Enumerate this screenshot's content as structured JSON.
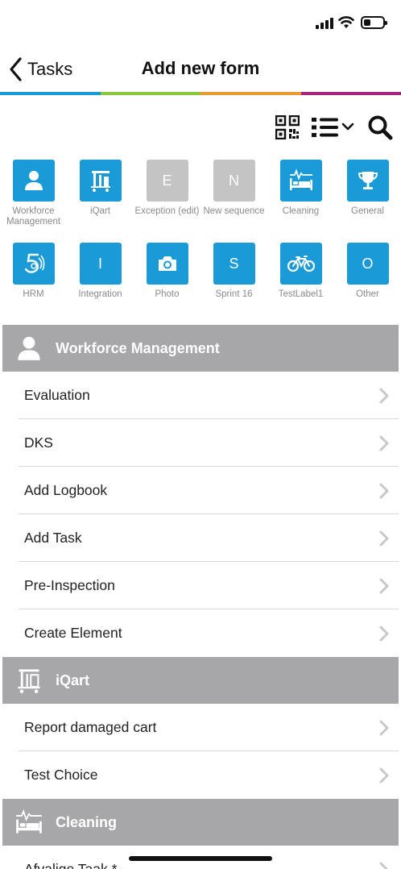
{
  "nav": {
    "back_label": "Tasks",
    "title": "Add new form"
  },
  "colors": {
    "accent": "#1a9bd7",
    "tile_disabled": "#c4c4c4",
    "section_header": "#a7a6a8",
    "rainbow": [
      "#1a9bd7",
      "#8cc63f",
      "#e89b2f",
      "#a8267b"
    ]
  },
  "toolbar": {
    "icons": [
      "qr-code-icon",
      "list-view-icon",
      "search-icon"
    ]
  },
  "tiles": [
    {
      "label": "Workforce Management",
      "icon": "person-icon"
    },
    {
      "label": "iQart",
      "icon": "cart-icon"
    },
    {
      "label": "Exception (edit)",
      "letter": "E",
      "disabled": true
    },
    {
      "label": "New sequence",
      "letter": "N",
      "disabled": true
    },
    {
      "label": "Cleaning",
      "icon": "bed-icon"
    },
    {
      "label": "General",
      "icon": "trophy-icon"
    },
    {
      "label": "HRM",
      "icon": "hrm-logo-icon"
    },
    {
      "label": "Integration",
      "letter": "I"
    },
    {
      "label": "Photo",
      "icon": "camera-icon"
    },
    {
      "label": "Sprint 16",
      "letter": "S"
    },
    {
      "label": "TestLabel1",
      "icon": "bicycle-icon"
    },
    {
      "label": "Other",
      "letter": "O"
    }
  ],
  "sections": [
    {
      "title": "Workforce Management",
      "icon": "person-icon",
      "items": [
        "Evaluation",
        "DKS",
        "Add Logbook",
        "Add Task",
        "Pre-Inspection",
        "Create Element"
      ]
    },
    {
      "title": "iQart",
      "icon": "cart-icon",
      "items": [
        "Report damaged cart",
        "Test Choice"
      ]
    },
    {
      "title": "Cleaning",
      "icon": "bed-icon",
      "items": [
        "Afvalige Taak *"
      ]
    }
  ]
}
